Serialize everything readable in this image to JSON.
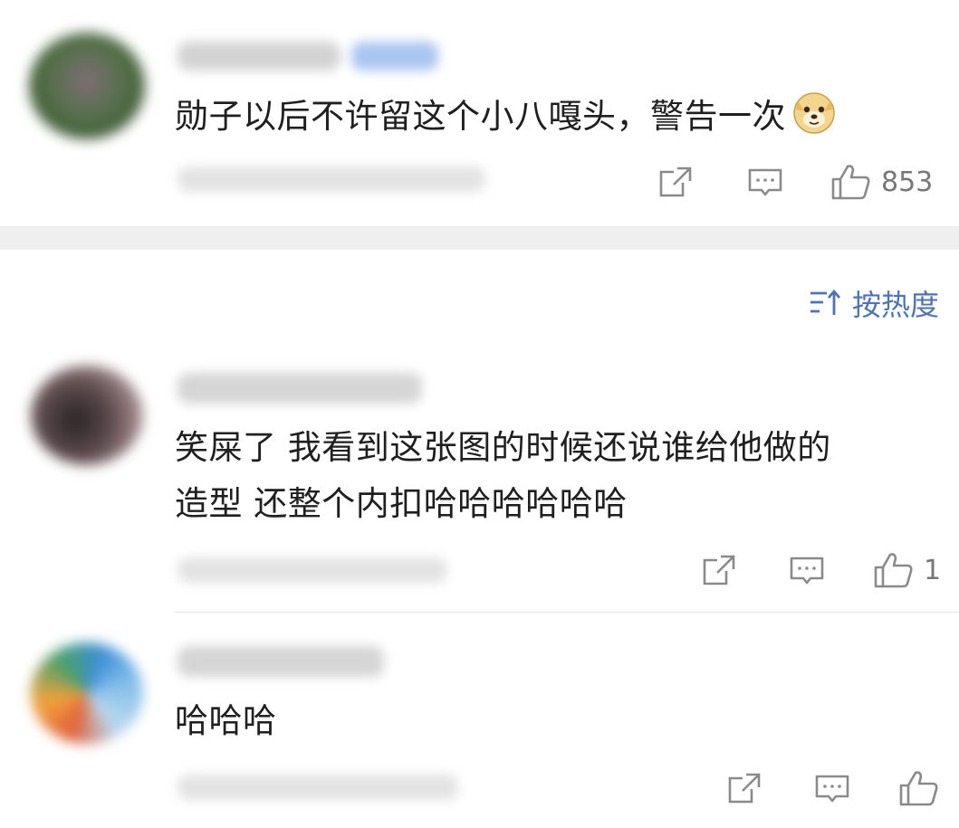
{
  "comments": [
    {
      "text": "勋子以后不许留这个小八嘎头，警告一次",
      "emoji": "doge-emoji",
      "likes": "853"
    },
    {
      "text_line1": "笑屎了 我看到这张图的时候还说谁给他做的",
      "text_line2": "造型 还整个内扣哈哈哈哈哈哈",
      "likes": "1"
    },
    {
      "text": "哈哈哈",
      "likes": ""
    }
  ],
  "sort": {
    "label": "按热度",
    "icon": "sort-icon"
  },
  "colors": {
    "accent": "#4e73b8",
    "icon_gray": "#8a8a8a",
    "band": "#efefef"
  }
}
